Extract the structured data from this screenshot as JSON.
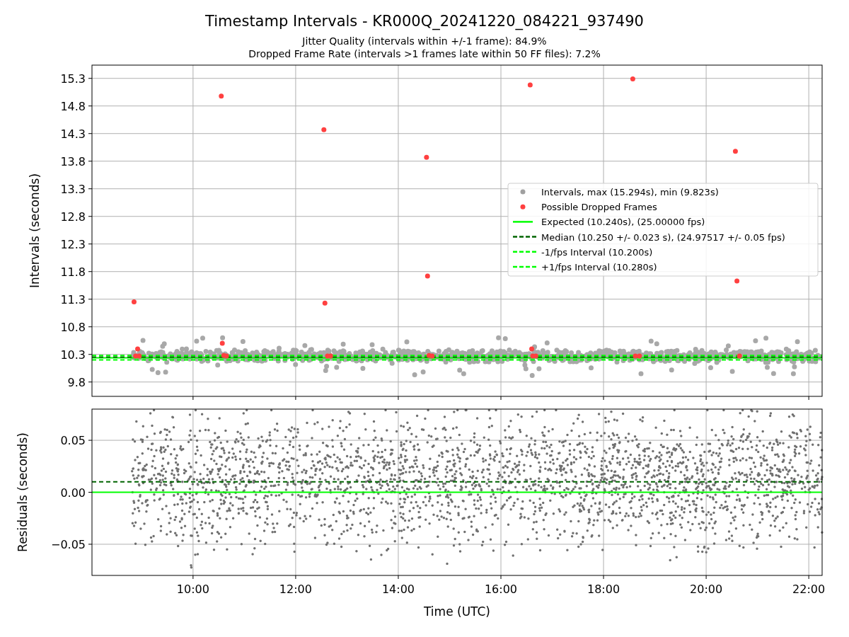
{
  "figure": {
    "title": "Timestamp Intervals - KR000Q_20241220_084221_937490",
    "subtitles": [
      "Jitter Quality (intervals within +/-1 frame): 84.9%",
      "Dropped Frame Rate (intervals >1 frames late within 50 FF files): 7.2%"
    ]
  },
  "legend": [
    {
      "label": "Intervals, max (15.294s), min (9.823s)",
      "color": "#a0a0a0"
    }
  ],
  "panels": [
    {
      "chart_data": {
        "type": "scatter",
        "ylabel": "Intervals (seconds)",
        "grid": true,
        "xlim": [
          8.03,
          22.26
        ],
        "ylim": [
          9.54,
          15.54
        ],
        "yticks": [
          {
            "value": 9.8,
            "label": "9.8"
          },
          {
            "value": 10.3,
            "label": "10.3"
          },
          {
            "value": 10.8,
            "label": "10.8"
          },
          {
            "value": 11.3,
            "label": "11.3"
          },
          {
            "value": 11.8,
            "label": "11.8"
          },
          {
            "value": 12.3,
            "label": "12.3"
          },
          {
            "value": 12.8,
            "label": "12.8"
          },
          {
            "value": 13.3,
            "label": "13.3"
          },
          {
            "value": 13.8,
            "label": "13.8"
          },
          {
            "value": 14.3,
            "label": "14.3"
          },
          {
            "value": 14.8,
            "label": "14.8"
          },
          {
            "value": 15.3,
            "label": "15.3"
          }
        ],
        "x": [
          8.85,
          8.88,
          8.92,
          8.95,
          10.55,
          10.57,
          10.6,
          10.65,
          12.55,
          12.57,
          12.62,
          12.68,
          14.55,
          14.57,
          14.6,
          14.66,
          16.57,
          16.6,
          16.62,
          16.68,
          18.57,
          18.62,
          18.7,
          20.57,
          20.6,
          20.65
        ],
        "series": [
          {
            "name": "Possible Dropped Frames",
            "color": "#ff4040",
            "values": [
              11.25,
              10.27,
              10.4,
              10.27,
              14.98,
              10.5,
              10.28,
              10.27,
              14.37,
              11.23,
              10.27,
              10.27,
              13.87,
              11.72,
              10.28,
              10.27,
              15.18,
              10.4,
              10.27,
              10.27,
              15.29,
              10.27,
              10.27,
              13.98,
              11.63,
              10.27
            ]
          }
        ],
        "ref_lines": [
          {
            "axis": "y",
            "value": 10.24,
            "color": "#00ff00",
            "label": "Expected (10.240s), (25.00000 fps)"
          },
          {
            "axis": "y",
            "value": 10.25,
            "color": "#006400",
            "label": "Median (10.250 +/- 0.023 s), (24.97517 +/- 0.05 fps)"
          },
          {
            "axis": "y",
            "value": 10.2,
            "color": "#00ff00",
            "label": "-1/fps Interval (10.200s)"
          },
          {
            "axis": "y",
            "value": 10.28,
            "color": "#00ff00",
            "label": "+1/fps Interval (10.280s)"
          }
        ]
      }
    },
    {
      "chart_data": {
        "type": "scatter",
        "ylabel": "Residuals (seconds)",
        "xlabel": "Time (UTC)",
        "grid": true,
        "xlim": [
          8.03,
          22.26
        ],
        "ylim": [
          -0.08,
          0.08
        ],
        "yticks": [
          {
            "value": 0.05,
            "label": "0.05"
          },
          {
            "value": 0,
            "label": "0.00"
          },
          {
            "value": -0.05,
            "label": "−0.05"
          }
        ],
        "xticks": [
          {
            "value": 10,
            "label": "10:00"
          },
          {
            "value": 12,
            "label": "12:00"
          },
          {
            "value": 14,
            "label": "14:00"
          },
          {
            "value": 16,
            "label": "16:00"
          },
          {
            "value": 18,
            "label": "18:00"
          },
          {
            "value": 20,
            "label": "20:00"
          },
          {
            "value": 22,
            "label": "22:00"
          }
        ],
        "ref_lines": [
          {
            "axis": "y",
            "value": 0,
            "color": "#00ff00"
          },
          {
            "axis": "y",
            "value": 0.01,
            "color": "#006400"
          }
        ]
      }
    }
  ]
}
